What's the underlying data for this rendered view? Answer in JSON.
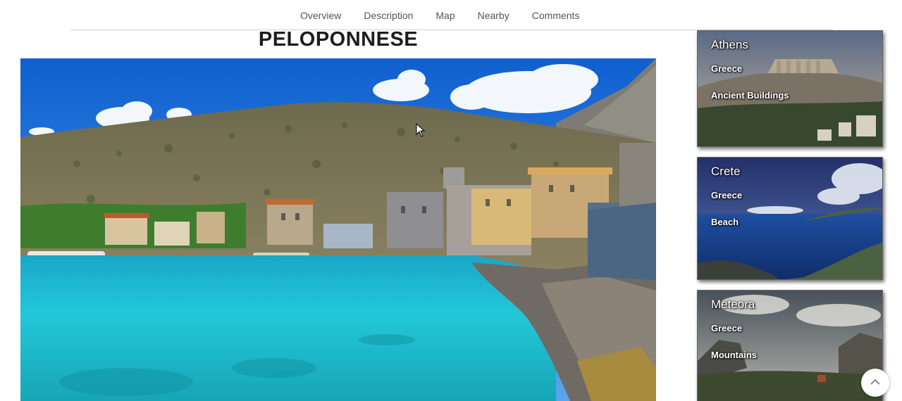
{
  "nav": {
    "items": [
      {
        "label": "Overview"
      },
      {
        "label": "Description"
      },
      {
        "label": "Map"
      },
      {
        "label": "Nearby"
      },
      {
        "label": "Comments"
      }
    ]
  },
  "page": {
    "title": "PELOPONNESE"
  },
  "sidebar": {
    "cards": [
      {
        "title": "Athens",
        "country": "Greece",
        "category": "Ancient Buildings"
      },
      {
        "title": "Crete",
        "country": "Greece",
        "category": "Beach"
      },
      {
        "title": "Meteora",
        "country": "Greece",
        "category": "Mountains"
      }
    ]
  },
  "icons": {
    "scroll_top": "chevron-up-icon",
    "cursor": "mouse-cursor-icon"
  },
  "colors": {
    "sea": "#22c7d6",
    "sky": "#1f6fd6",
    "title": "#1e1e1e"
  }
}
